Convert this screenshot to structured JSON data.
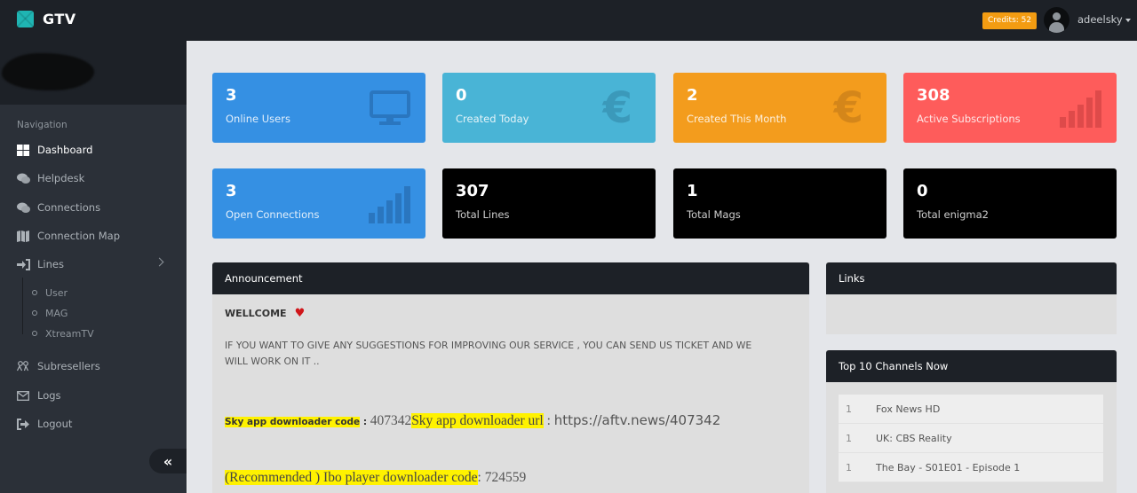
{
  "app": {
    "brand_name": "GTV",
    "credits_label": "Credits: 52",
    "username": "adeelsky"
  },
  "sidebar": {
    "nav_title": "Navigation",
    "items": [
      {
        "label": "Dashboard",
        "icon": "dashboard-icon",
        "active": true
      },
      {
        "label": "Helpdesk",
        "icon": "comments-icon"
      },
      {
        "label": "Connections",
        "icon": "comments-icon"
      },
      {
        "label": "Connection Map",
        "icon": "map-icon"
      },
      {
        "label": "Lines",
        "icon": "sign-in-icon",
        "expandable": true
      },
      {
        "label": "Subresellers",
        "icon": "users-icon"
      },
      {
        "label": "Logs",
        "icon": "envelope-icon"
      },
      {
        "label": "Logout",
        "icon": "sign-out-icon"
      }
    ],
    "lines_subitems": [
      {
        "label": "User"
      },
      {
        "label": "MAG"
      },
      {
        "label": "XtreamTV"
      }
    ],
    "collapse_icon": "«"
  },
  "stats": [
    {
      "value": "3",
      "label": "Online Users",
      "icon": "monitor-icon",
      "color": "#3590e3"
    },
    {
      "value": "0",
      "label": "Created Today",
      "icon": "euro-icon",
      "color": "#49b4d6"
    },
    {
      "value": "2",
      "label": "Created This Month",
      "icon": "euro-icon",
      "color": "#f39c1d"
    },
    {
      "value": "308",
      "label": "Active Subscriptions",
      "icon": "signal-bars-icon",
      "color": "#fe5c5b"
    },
    {
      "value": "3",
      "label": "Open Connections",
      "icon": "signal-bars-icon",
      "color": "#3590e3"
    },
    {
      "value": "307",
      "label": "Total Lines",
      "color": "#000000"
    },
    {
      "value": "1",
      "label": "Total Mags",
      "color": "#000000"
    },
    {
      "value": "0",
      "label": "Total enigma2",
      "color": "#000000"
    }
  ],
  "announcement": {
    "title": "Announcement",
    "welcome": "WELLCOME",
    "welcome_icon": "heart-icon",
    "message": "IF YOU WANT TO GIVE ANY SUGGESTIONS FOR IMPROVING OUR SERVICE , YOU CAN SEND US TICKET AND WE WILL WORK ON IT ..",
    "sky_code_label": "Sky app downloader code",
    "sky_code_sep": " : ",
    "sky_code_value": "407342",
    "sky_url_label": "Sky app downloader url",
    "sky_url_sep": " : ",
    "sky_url_value": "https://aftv.news/407342",
    "ibo_label": "(Recommended ) Ibo player downloader code",
    "ibo_sep": ": ",
    "ibo_value": "724559"
  },
  "links": {
    "title": "Links"
  },
  "top_channels": {
    "title": "Top 10 Channels Now",
    "rows": [
      {
        "rank": "1",
        "name": "Fox News HD"
      },
      {
        "rank": "1",
        "name": "UK: CBS Reality"
      },
      {
        "rank": "1",
        "name": "The Bay - S01E01 - Episode 1"
      }
    ]
  }
}
